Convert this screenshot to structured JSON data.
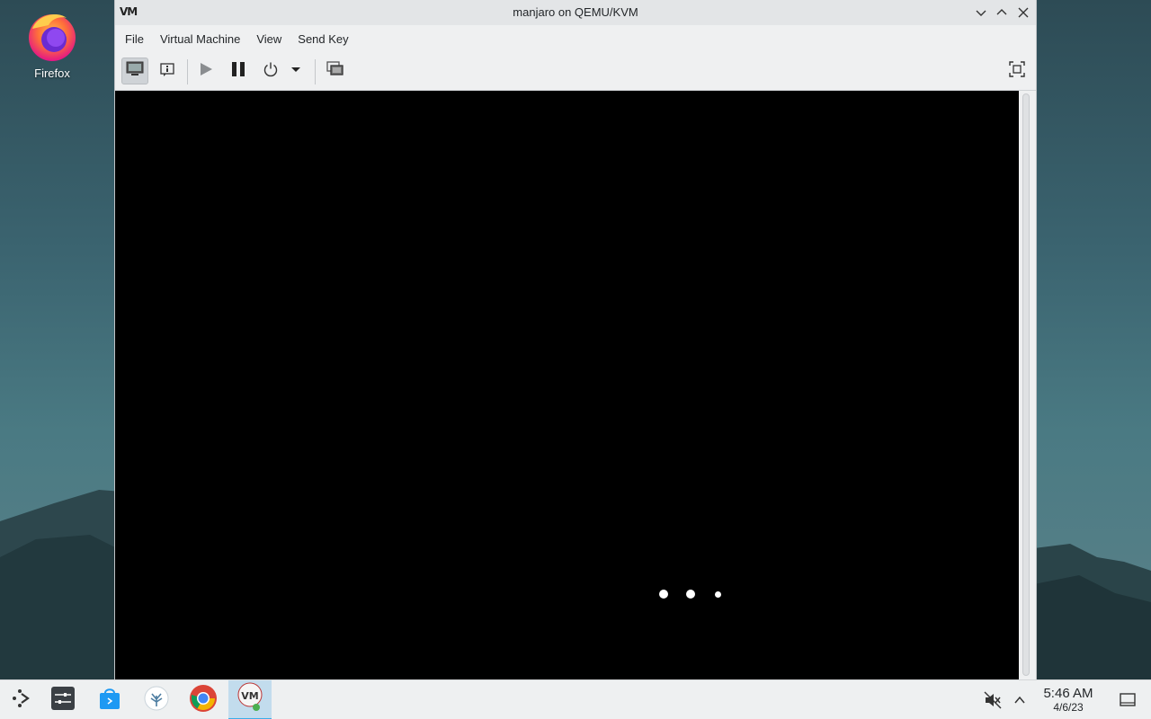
{
  "desktop": {
    "icons": [
      {
        "label": "Firefox",
        "icon": "firefox-icon"
      }
    ]
  },
  "window": {
    "title": "manjaro on QEMU/KVM",
    "app_logo": "VM",
    "controls": {
      "minimize": "minimize-icon",
      "maximize": "maximize-icon",
      "close": "close-icon"
    },
    "menu": [
      "File",
      "Virtual Machine",
      "View",
      "Send Key"
    ],
    "toolbar": [
      "console-icon",
      "details-icon",
      "run-icon",
      "pause-icon",
      "power-icon",
      "power-menu-chevron-icon",
      "snapshots-icon",
      "fullscreen-icon"
    ]
  },
  "vm_screen": {
    "background": "#000000",
    "loading_dots": 3
  },
  "taskbar": {
    "items": [
      "app-launcher-icon",
      "system-settings-icon",
      "discover-store-icon",
      "kde-connect-icon",
      "chrome-icon",
      "virt-manager-icon"
    ],
    "tray": [
      "audio-muted-icon",
      "tray-expand-icon"
    ],
    "time": "5:46 AM",
    "date": "4/6/23",
    "show_desktop": "show-desktop-icon"
  },
  "colors": {
    "accent": "#3daee9",
    "window_bg": "#eff0f1",
    "taskbar_bg": "#eef0f1"
  }
}
